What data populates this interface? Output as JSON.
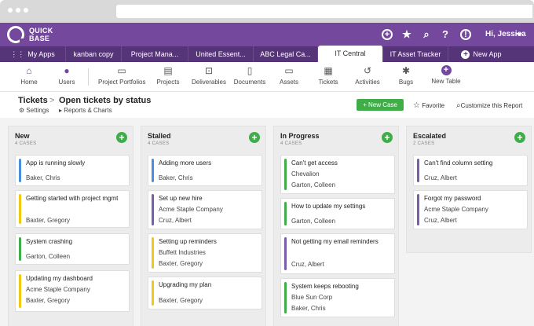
{
  "app": {
    "logo_text_1": "QUICK",
    "logo_text_2": "BASE",
    "user_label": "Hi, Jessica"
  },
  "top_icons": [
    "plus-circle-icon",
    "star-icon",
    "search-icon",
    "help-icon",
    "alert-icon"
  ],
  "tabs": [
    {
      "label": "My Apps",
      "icon": "grid-icon"
    },
    {
      "label": "kanban copy"
    },
    {
      "label": "Project Mana..."
    },
    {
      "label": "United Essent..."
    },
    {
      "label": "ABC Legal Ca..."
    },
    {
      "label": "IT Central",
      "active": true
    },
    {
      "label": "IT Asset Tracker"
    },
    {
      "label": "New App",
      "icon": "plus-icon"
    }
  ],
  "toolbar": [
    {
      "label": "Home",
      "icon": "home-icon"
    },
    {
      "label": "Users",
      "icon": "user-icon"
    },
    {
      "label": "Project Portfolios",
      "icon": "bookmark-icon"
    },
    {
      "label": "Projects",
      "icon": "folder-icon"
    },
    {
      "label": "Deliverables",
      "icon": "cart-icon"
    },
    {
      "label": "Documents",
      "icon": "documents-icon"
    },
    {
      "label": "Assets",
      "icon": "monitor-icon"
    },
    {
      "label": "Tickets",
      "icon": "ticket-icon"
    },
    {
      "label": "Activities",
      "icon": "activity-icon"
    },
    {
      "label": "Bugs",
      "icon": "bug-icon"
    },
    {
      "label": "New Table",
      "icon": "plus-circle-icon"
    }
  ],
  "header": {
    "breadcrumb_root": "Tickets",
    "breadcrumb_sep": ">",
    "title": "Open tickets by status",
    "settings_label": "Settings",
    "reports_label": "Reports & Charts",
    "new_case_label": "+ New Case",
    "favorite_label": "Favorite",
    "customize_label": "Customize this Report"
  },
  "colors": {
    "brand": "#74489d",
    "tab_bar": "#553477",
    "add_green": "#3fae49",
    "blue": "#4a90d9",
    "yellow": "#f2c912",
    "green": "#3fae49",
    "purple": "#7b5ea7"
  },
  "columns": [
    {
      "title": "New",
      "count": "4 CASES",
      "cards": [
        {
          "title": "App is running slowly",
          "lines": [
            "Baker, Chris"
          ],
          "color": "blue"
        },
        {
          "title": "Getting started with project mgmt",
          "lines": [
            "Baxter, Gregory"
          ],
          "color": "yellow"
        },
        {
          "title": "System crashing",
          "lines": [
            "Garton, Colleen"
          ],
          "color": "green"
        },
        {
          "title": "Updating my dashboard",
          "lines": [
            "Acme Staple Company",
            "Baxter, Gregory"
          ],
          "color": "yellow"
        }
      ]
    },
    {
      "title": "Stalled",
      "count": "4 CASES",
      "cards": [
        {
          "title": "Adding more users",
          "lines": [
            "Baker, Chris"
          ],
          "color": "blue"
        },
        {
          "title": "Set up new hire",
          "lines": [
            "Acme Staple Company",
            "Cruz, Albert"
          ],
          "color": "purple"
        },
        {
          "title": "Setting up reminders",
          "lines": [
            "Buffett Industries",
            "Baxter, Gregory"
          ],
          "color": "yellow"
        },
        {
          "title": "Upgrading my plan",
          "lines": [
            "Baxter, Gregory"
          ],
          "color": "yellow"
        }
      ]
    },
    {
      "title": "In Progress",
      "count": "4 CASES",
      "cards": [
        {
          "title": "Can't get access",
          "lines": [
            "Chevalion",
            "Garton, Colleen"
          ],
          "color": "green"
        },
        {
          "title": "How to update my settings",
          "lines": [
            "Garton, Colleen"
          ],
          "color": "green"
        },
        {
          "title": "Not getting my email reminders",
          "lines": [
            "Cruz, Albert"
          ],
          "color": "purple"
        },
        {
          "title": "System keeps rebooting",
          "lines": [
            "Blue Sun Corp",
            "Baker, Chris"
          ],
          "color": "green"
        }
      ]
    },
    {
      "title": "Escalated",
      "count": "2 CASES",
      "cards": [
        {
          "title": "Can't find column setting",
          "lines": [
            "Cruz, Albert"
          ],
          "color": "purple"
        },
        {
          "title": "Forgot my password",
          "lines": [
            "Acme Staple Company",
            "Cruz, Albert"
          ],
          "color": "purple"
        }
      ]
    }
  ]
}
